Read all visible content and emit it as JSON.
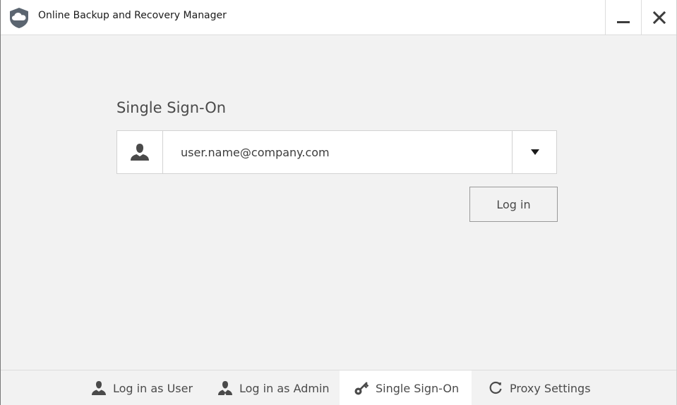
{
  "window": {
    "title": "Online Backup and Recovery Manager"
  },
  "main": {
    "section_title": "Single Sign-On",
    "email_value": "user.name@company.com",
    "login_label": "Log in"
  },
  "tabs": [
    {
      "label": "Log in as User",
      "icon": "user-icon",
      "active": false
    },
    {
      "label": "Log in as Admin",
      "icon": "admin-icon",
      "active": false
    },
    {
      "label": "Single Sign-On",
      "icon": "key-icon",
      "active": true
    },
    {
      "label": "Proxy Settings",
      "icon": "sync-icon",
      "active": false
    }
  ],
  "colors": {
    "background": "#f2f2f2",
    "active_tab": "#ffffff",
    "icon": "#4a4a4a"
  }
}
